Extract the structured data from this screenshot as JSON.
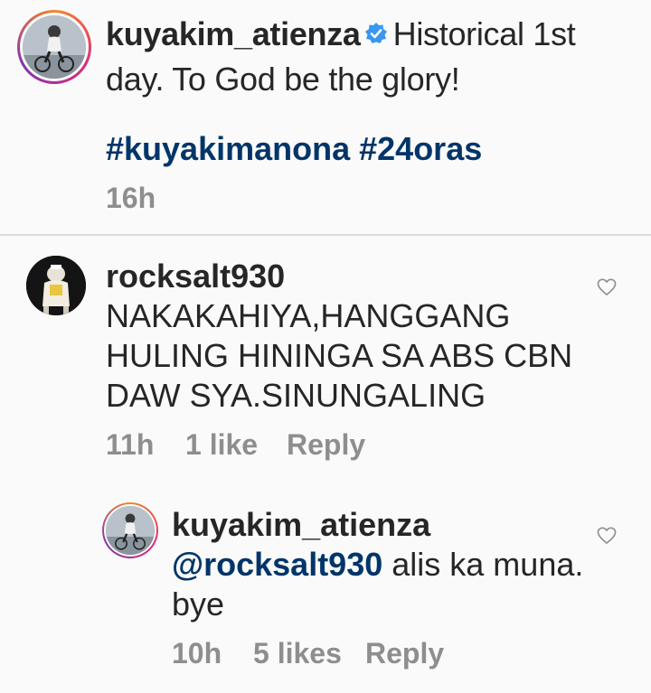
{
  "caption": {
    "username": "kuyakim_atienza",
    "verified": true,
    "text": "Historical 1st day. To God be the glory!",
    "hashtags": [
      "#kuyakimanona",
      "#24oras"
    ],
    "time": "16h"
  },
  "comments": [
    {
      "username": "rocksalt930",
      "text": "NAKAKAHIYA,HANGGANG HULING HININGA SA ABS CBN DAW SYA.SINUNGALING",
      "time": "11h",
      "likes": "1 like",
      "reply_label": "Reply",
      "icon": "heart-outline-icon"
    },
    {
      "username": "kuyakim_atienza",
      "mention": "@rocksalt930",
      "text": "alis ka muna. bye",
      "time": "10h",
      "likes": "5 likes",
      "reply_label": "Reply",
      "icon": "heart-outline-icon"
    }
  ],
  "colors": {
    "background": "#fafafa",
    "text": "#262626",
    "link": "#003569",
    "muted": "#8e8e8e",
    "verified": "#3897f0",
    "divider": "#dbdbdb"
  }
}
